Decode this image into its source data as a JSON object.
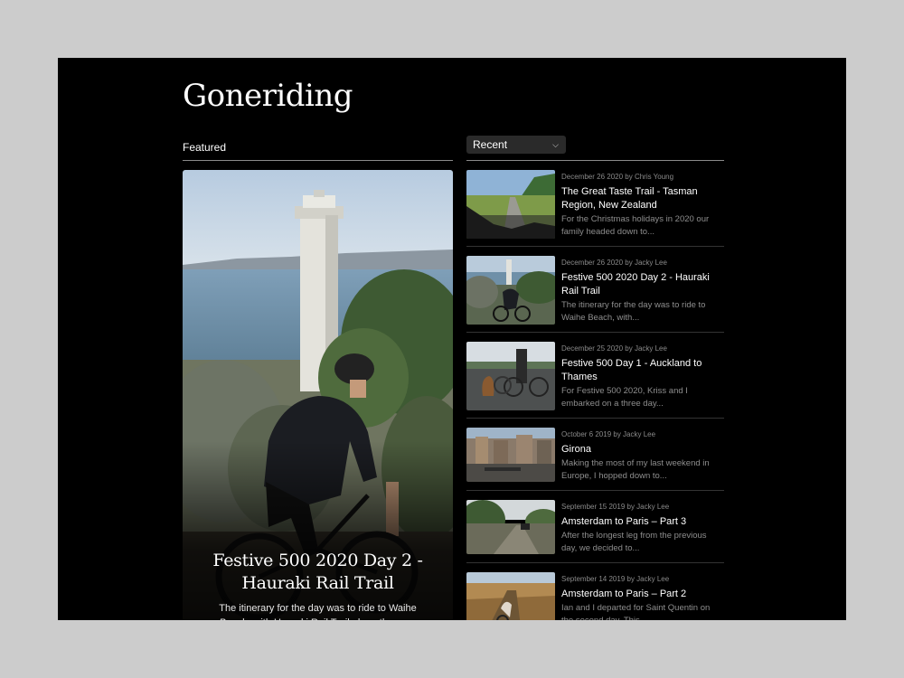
{
  "site": {
    "title": "Goneriding"
  },
  "featured": {
    "label": "Featured",
    "post": {
      "title": "Festive 500 2020 Day 2 - Hauraki Rail Trail",
      "excerpt": "The itinerary for the day was to ride to Waihe Beach, with Hauraki Rail Trail along the way. From"
    }
  },
  "recent": {
    "select_value": "Recent",
    "chevron_icon": "chevron-down-icon",
    "posts": [
      {
        "meta": "December 26 2020 by Chris Young",
        "title": "The Great Taste Trail - Tasman Region, New Zealand",
        "excerpt": "For the Christmas holidays in 2020 our family headed down to..."
      },
      {
        "meta": "December 26 2020 by Jacky Lee",
        "title": "Festive 500 2020 Day 2 - Hauraki Rail Trail",
        "excerpt": "The itinerary for the day was to ride to Waihe Beach, with..."
      },
      {
        "meta": "December 25 2020 by Jacky Lee",
        "title": "Festive 500 Day 1 - Auckland to Thames",
        "excerpt": "For Festive 500 2020, Kriss and I embarked on a three day..."
      },
      {
        "meta": "October 6 2019 by Jacky Lee",
        "title": "Girona",
        "excerpt": "Making the most of my last weekend in Europe, I hopped down to..."
      },
      {
        "meta": "September 15 2019 by Jacky Lee",
        "title": "Amsterdam to Paris – Part 3",
        "excerpt": "After the longest leg from the previous day, we decided to..."
      },
      {
        "meta": "September 14 2019 by Jacky Lee",
        "title": "Amsterdam to Paris – Part 2",
        "excerpt": "Ian and I departed for Saint Quentin on the second day. This..."
      }
    ]
  }
}
